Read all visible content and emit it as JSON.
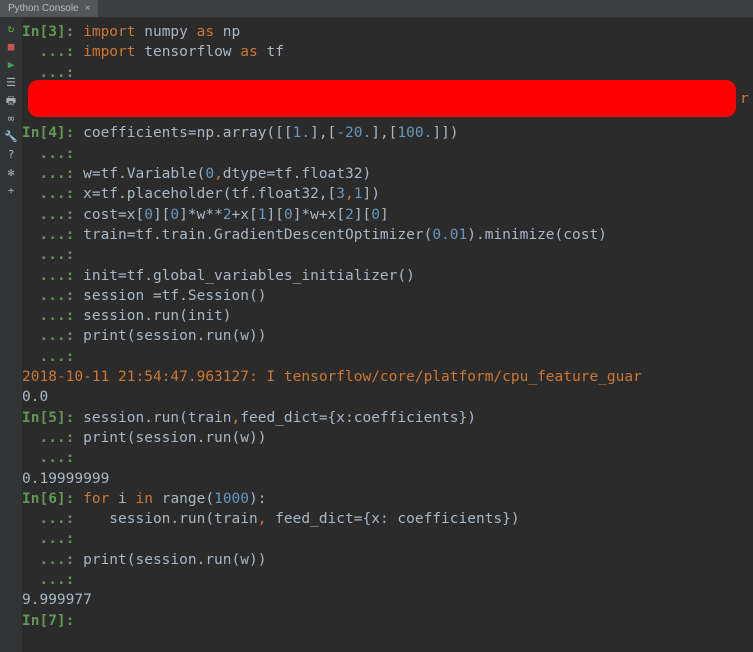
{
  "tab": {
    "label": "Python Console",
    "closable": true
  },
  "gutter": {
    "icons": [
      {
        "name": "rerun-icon",
        "glyph": "↻"
      },
      {
        "name": "stop-icon",
        "glyph": "■"
      },
      {
        "name": "run-icon",
        "glyph": "▶"
      },
      {
        "name": "list-icon",
        "glyph": "☰"
      },
      {
        "name": "print-icon",
        "glyph": "🖶"
      },
      {
        "name": "link-icon",
        "glyph": "∞"
      },
      {
        "name": "settings-icon",
        "glyph": "🔧"
      },
      {
        "name": "help-icon",
        "glyph": "?"
      },
      {
        "name": "gear-icon",
        "glyph": "✻"
      },
      {
        "name": "add-icon",
        "glyph": "+"
      }
    ]
  },
  "console": {
    "in3": {
      "prompt": "In[3]: ",
      "l1a": "import",
      "l1b": " numpy ",
      "l1c": "as",
      "l1d": " np",
      "l2a": "import",
      "l2b": " tensorflow ",
      "l2c": "as",
      "l2d": " tf"
    },
    "dots": "  ...: ",
    "in4": {
      "prompt": "In[4]: ",
      "l1a": "coefficients=np.array([[",
      "l1b": "1.",
      "l1c": "],[",
      "l1d": "-20.",
      "l1e": "],[",
      "l1f": "100.",
      "l1g": "]])",
      "l2a": "w=tf.Variable(",
      "l2b": "0",
      "l2c": ",",
      "l2d": "dtype=tf.float32)",
      "l3a": "x=tf.placeholder(tf.float32,[",
      "l3b": "3",
      "l3c": ",",
      "l3d": "1",
      "l3e": "])",
      "l4a": "cost=x[",
      "l4b": "0",
      "l4c": "][",
      "l4d": "0",
      "l4e": "]*w**",
      "l4f": "2",
      "l4g": "+x[",
      "l4h": "1",
      "l4i": "][",
      "l4j": "0",
      "l4k": "]*w+x[",
      "l4l": "2",
      "l4m": "][",
      "l4n": "0",
      "l4o": "]",
      "l5a": "train=tf.train.GradientDescentOptimizer(",
      "l5b": "0.01",
      "l5c": ").minimize(cost)",
      "l6": "init=tf.global_variables_initializer()",
      "l7": "session =tf.Session()",
      "l8": "session.run(init)",
      "l9": "print(session.run(w))"
    },
    "log": {
      "ts": "2018-10-11 21:54:47.963127: I ",
      "msg": "tensorflow/core/platform/cpu_feature_guar"
    },
    "out4": "0.0",
    "in5": {
      "prompt": "In[5]: ",
      "l1a": "session.run(train",
      "l1b": ",",
      "l1c": "feed_dict={x:coefficients})",
      "l2": "print(session.run(w))"
    },
    "out5": "0.19999999",
    "in6": {
      "prompt": "In[6]: ",
      "l1a": "for",
      "l1b": " i ",
      "l1c": "in",
      "l1d": " range(",
      "l1e": "1000",
      "l1f": "):",
      "l2a": "   session.run(train",
      "l2b": ",",
      "l2c": " feed_dict={x: coefficients})",
      "l3": "print(session.run(w))"
    },
    "out6": "9.999977",
    "in7": {
      "prompt": "In[7]: "
    },
    "orange_r": "r"
  }
}
